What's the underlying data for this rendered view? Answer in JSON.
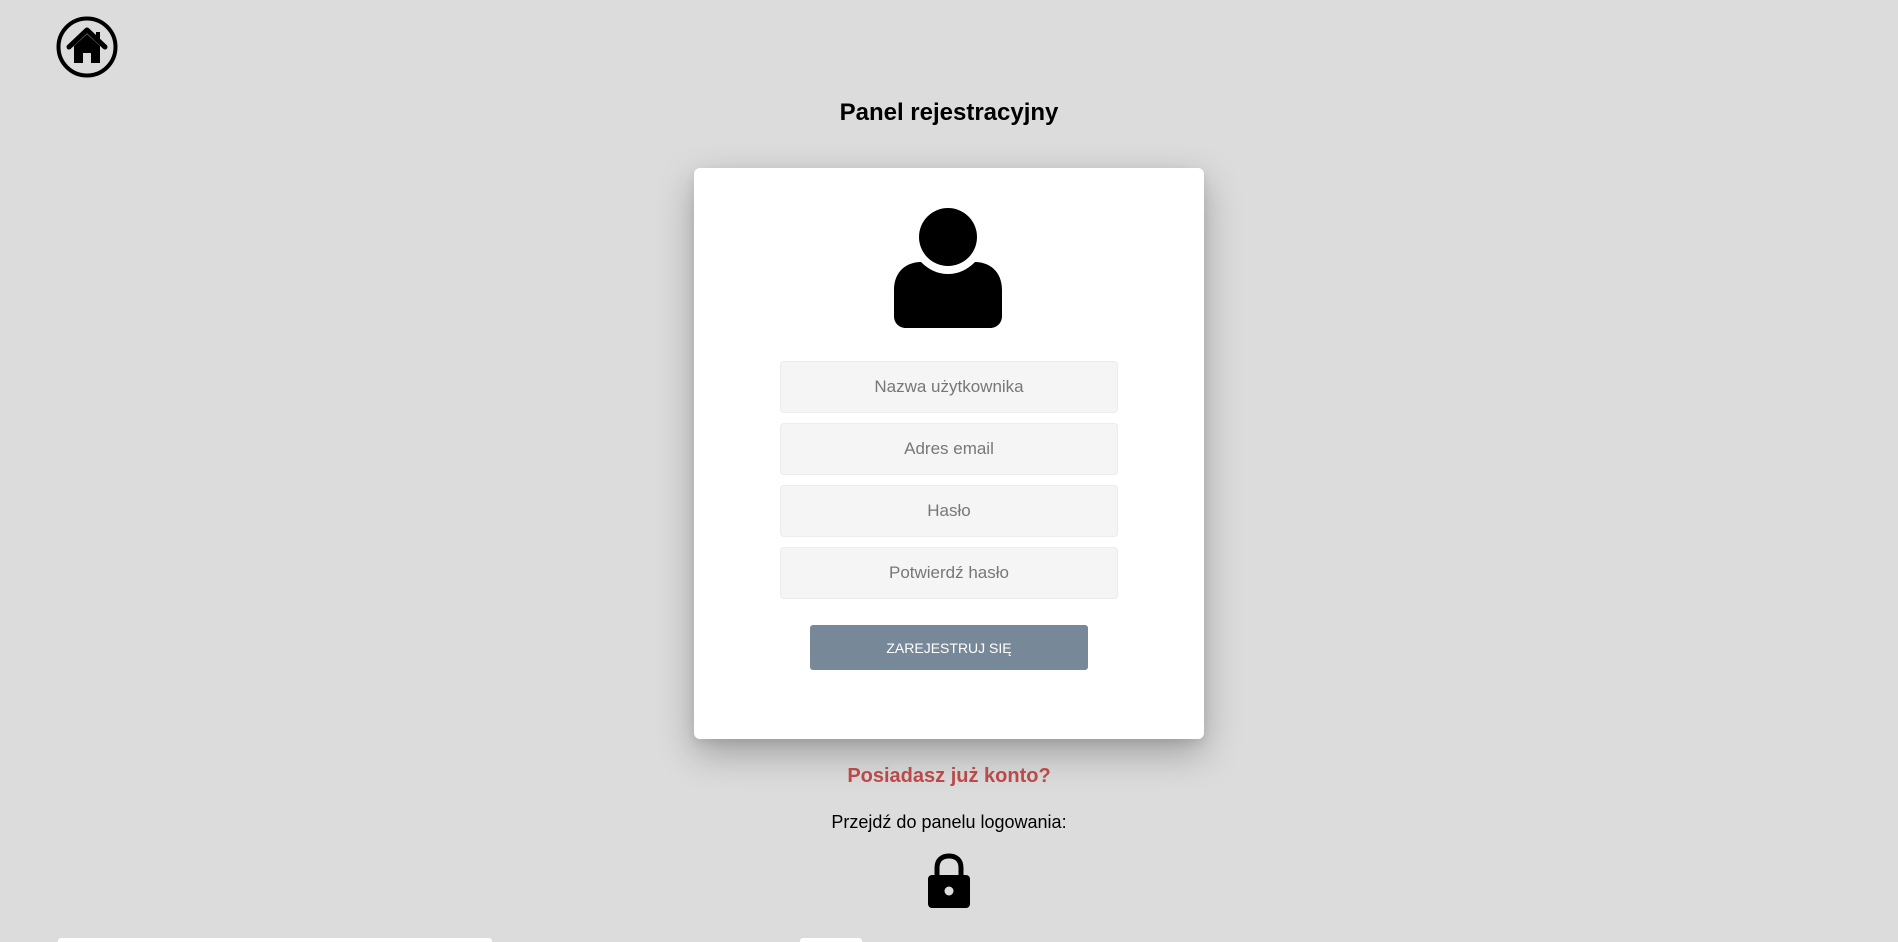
{
  "header": {
    "home_icon": "home-icon"
  },
  "page": {
    "title": "Panel rejestracyjny"
  },
  "form": {
    "avatar_icon": "user-icon",
    "username_placeholder": "Nazwa użytkownika",
    "email_placeholder": "Adres email",
    "password_placeholder": "Hasło",
    "confirm_password_placeholder": "Potwierdź hasło",
    "username_value": "",
    "email_value": "",
    "password_value": "",
    "confirm_password_value": "",
    "submit_label": "ZAREJESTRUJ SIĘ"
  },
  "footer": {
    "account_question": "Posiadasz już konto?",
    "login_prompt": "Przejdź do panelu logowania:",
    "lock_icon": "lock-icon"
  },
  "colors": {
    "background": "#dcdcdc",
    "card": "#ffffff",
    "button": "#778899",
    "accent_text": "#b94a48"
  }
}
